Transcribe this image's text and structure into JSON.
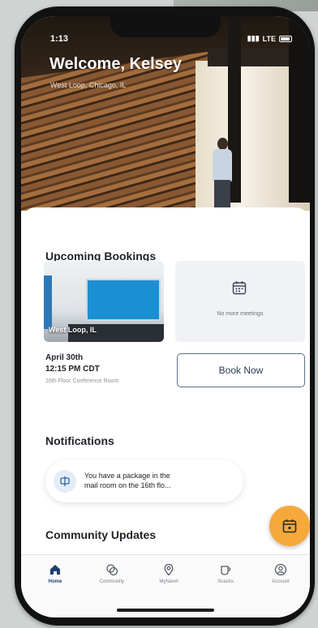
{
  "status": {
    "time": "1:13",
    "carrier": "LTE"
  },
  "header": {
    "welcome": "Welcome, Kelsey",
    "location": "West Loop, Chicago, IL"
  },
  "bookings": {
    "title": "Upcoming Bookings",
    "photo_label": "West Loop, IL",
    "empty_text": "No more meetings",
    "date": "April 30th",
    "time": "12:15 PM CDT",
    "room": "16th Floor Conference Room",
    "book_now": "Book Now"
  },
  "notifications": {
    "title": "Notifications",
    "line1": "You have a package in the",
    "line2": "mail room on the 16th flo..."
  },
  "community": {
    "title": "Community Updates"
  },
  "tabs": [
    {
      "label": "Home",
      "icon": "home-icon"
    },
    {
      "label": "Community",
      "icon": "community-icon"
    },
    {
      "label": "MyNavel",
      "icon": "map-pin-icon"
    },
    {
      "label": "Snacks",
      "icon": "cup-icon"
    },
    {
      "label": "Account",
      "icon": "account-icon"
    }
  ],
  "colors": {
    "accent": "#f4a93a",
    "primary": "#1f3f6e",
    "outline": "#5f6f8a"
  }
}
